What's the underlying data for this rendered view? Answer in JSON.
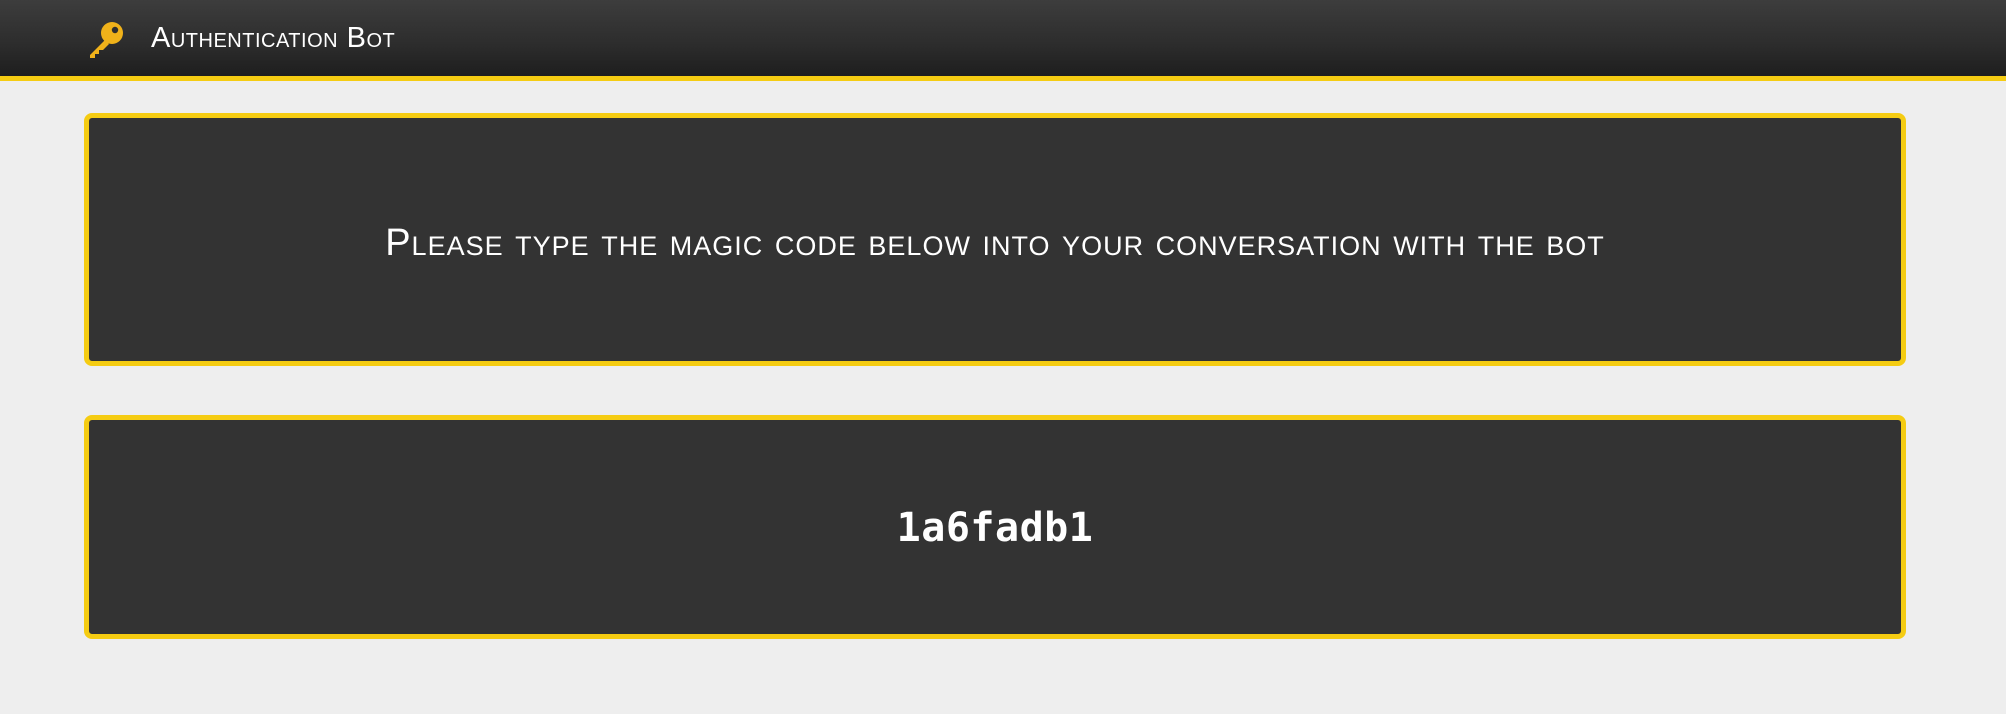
{
  "header": {
    "icon": "key-icon",
    "title": "Authentication Bot"
  },
  "instructions": {
    "text": "Please type the magic code below into your conversation with the bot"
  },
  "code": {
    "value": "1a6fadb1"
  },
  "colors": {
    "accent": "#f5cc12",
    "panel_background": "#333333",
    "page_background": "#eeeeee",
    "header_background": "#2c2c2c",
    "text": "#ffffff",
    "icon": "#f0b21a"
  }
}
